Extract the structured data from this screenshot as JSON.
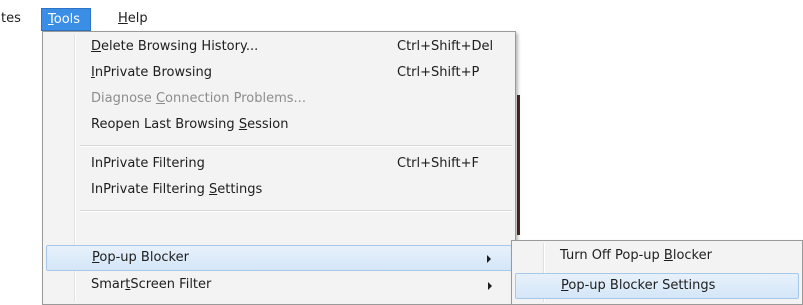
{
  "menubar": {
    "items": [
      {
        "label": "tes"
      },
      {
        "label": "Tools",
        "accel": "T",
        "rest": "ools"
      },
      {
        "label": "Help",
        "accel": "H",
        "rest": "elp"
      }
    ]
  },
  "tools_menu": {
    "items": [
      {
        "pre": "",
        "accel": "D",
        "post": "elete Browsing History...",
        "shortcut": "Ctrl+Shift+Del",
        "enabled": true
      },
      {
        "pre": "",
        "accel": "I",
        "post": "nPrivate Browsing",
        "shortcut": "Ctrl+Shift+P",
        "enabled": true
      },
      {
        "pre": "Diagnose ",
        "accel": "C",
        "post": "onnection Problems...",
        "shortcut": "",
        "enabled": false
      },
      {
        "pre": "Reopen Last Browsing ",
        "accel": "S",
        "post": "ession",
        "shortcut": "",
        "enabled": true
      },
      {
        "pre": "InPrivate Filtering",
        "accel": "",
        "post": "",
        "shortcut": "Ctrl+Shift+F",
        "enabled": true
      },
      {
        "pre": "InPrivate Filtering ",
        "accel": "S",
        "post": "ettings",
        "shortcut": "",
        "enabled": true
      },
      {
        "pre": "",
        "accel": "P",
        "post": "op-up Blocker",
        "shortcut": "",
        "enabled": true,
        "submenu": true,
        "highlighted": true
      },
      {
        "pre": "Smar",
        "accel": "t",
        "post": "Screen Filter",
        "shortcut": "",
        "enabled": true,
        "submenu": true
      }
    ]
  },
  "popup_blocker_menu": {
    "items": [
      {
        "pre": "Turn Off Pop-up ",
        "accel": "B",
        "post": "locker"
      },
      {
        "pre": "",
        "accel": "P",
        "post": "op-up Blocker Settings",
        "highlighted": true
      }
    ]
  }
}
